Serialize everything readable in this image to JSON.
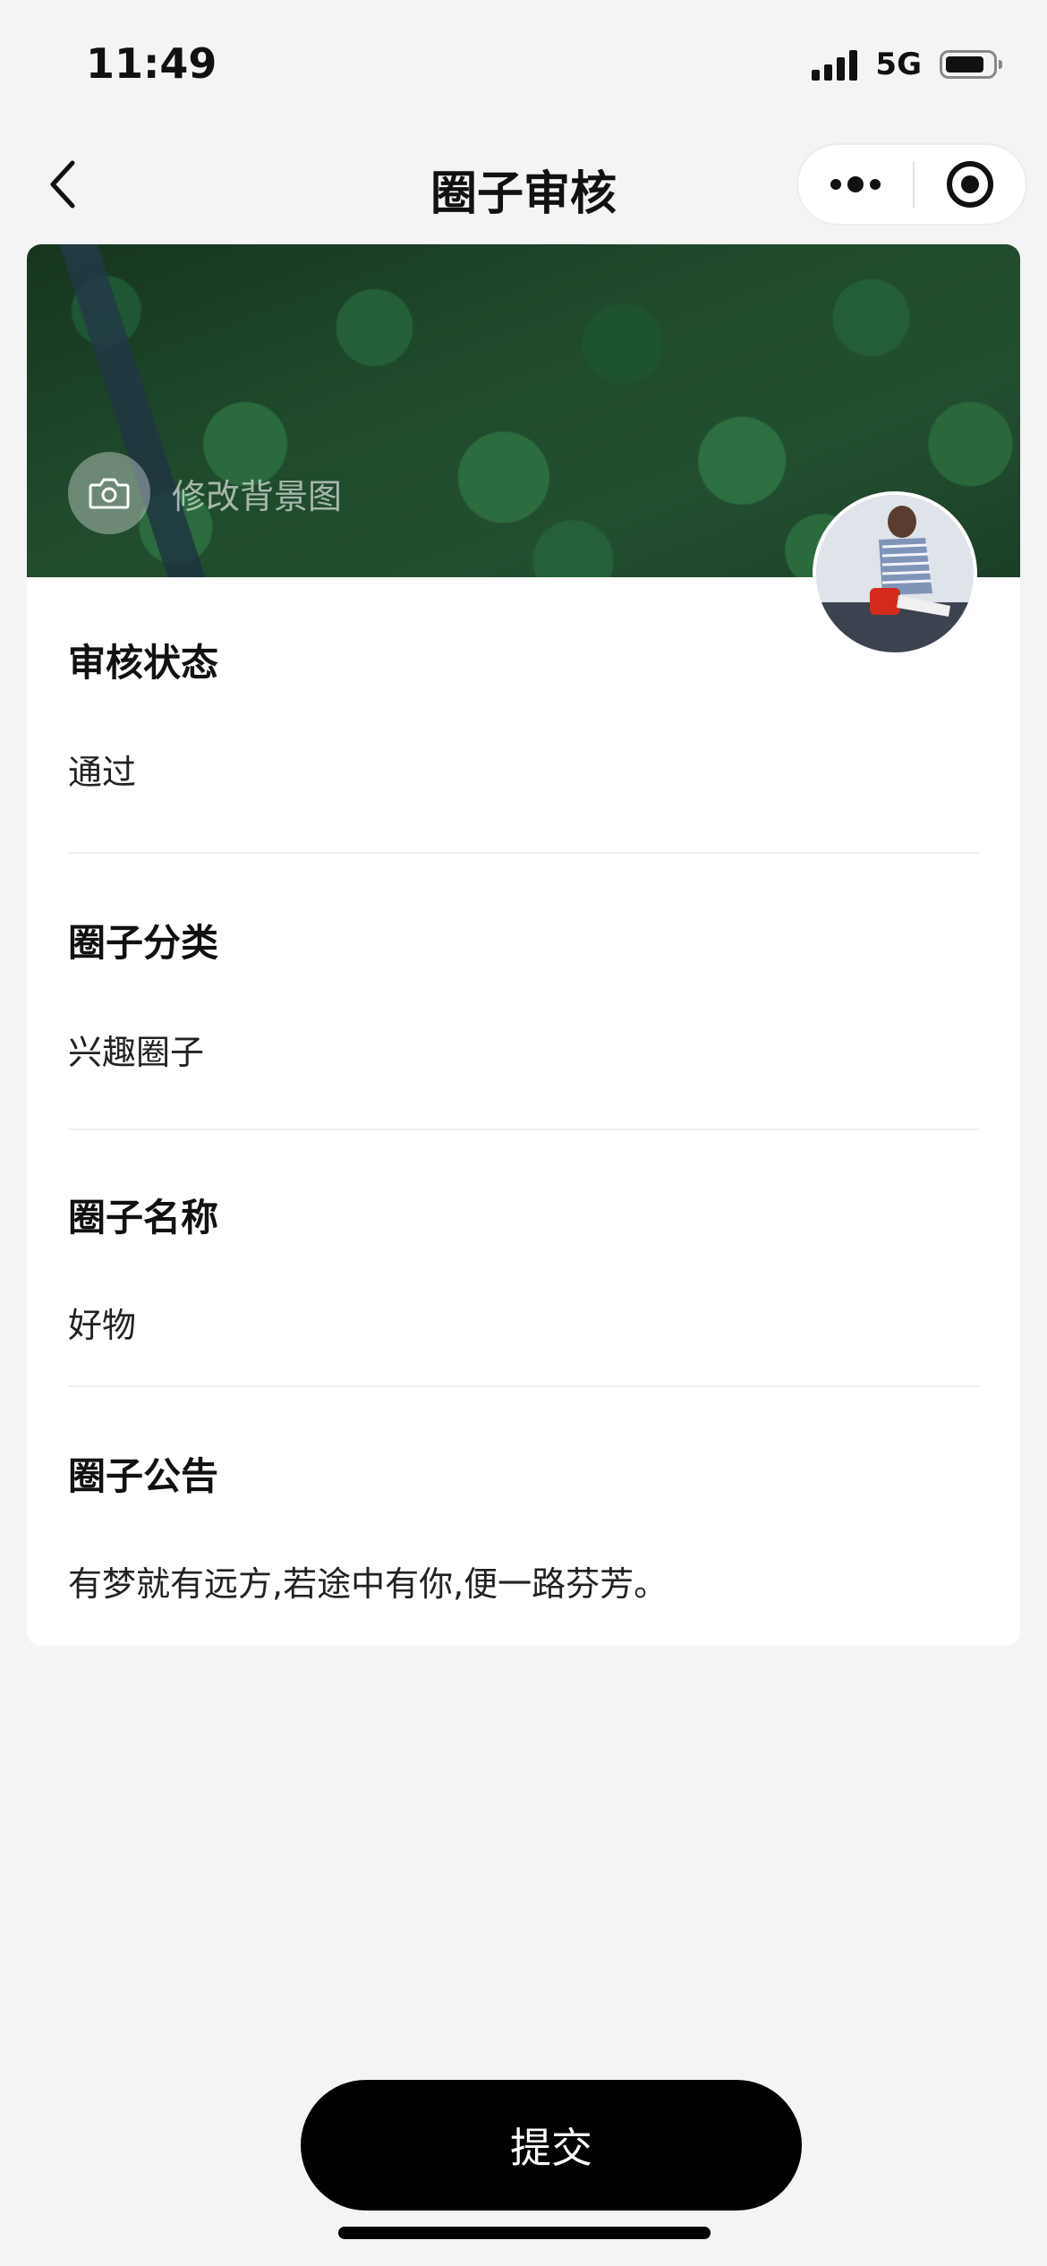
{
  "status_bar": {
    "time": "11:49",
    "network": "5G"
  },
  "nav": {
    "title": "圈子审核",
    "icons": {
      "back": "chevron-left-icon",
      "more": "more-dots-icon",
      "close": "target-circle-icon"
    }
  },
  "banner": {
    "change_background_label": "修改背景图",
    "icon": "camera-icon"
  },
  "fields": {
    "status": {
      "label": "审核状态",
      "value": "通过"
    },
    "category": {
      "label": "圈子分类",
      "value": "兴趣圈子"
    },
    "name": {
      "label": "圈子名称",
      "value": "好物"
    },
    "announcement": {
      "label": "圈子公告",
      "value": "有梦就有远方,若途中有你,便一路芬芳。"
    }
  },
  "submit": {
    "label": "提交"
  },
  "colors": {
    "background": "#f4f4f4",
    "card": "#ffffff",
    "button": "#000000"
  }
}
